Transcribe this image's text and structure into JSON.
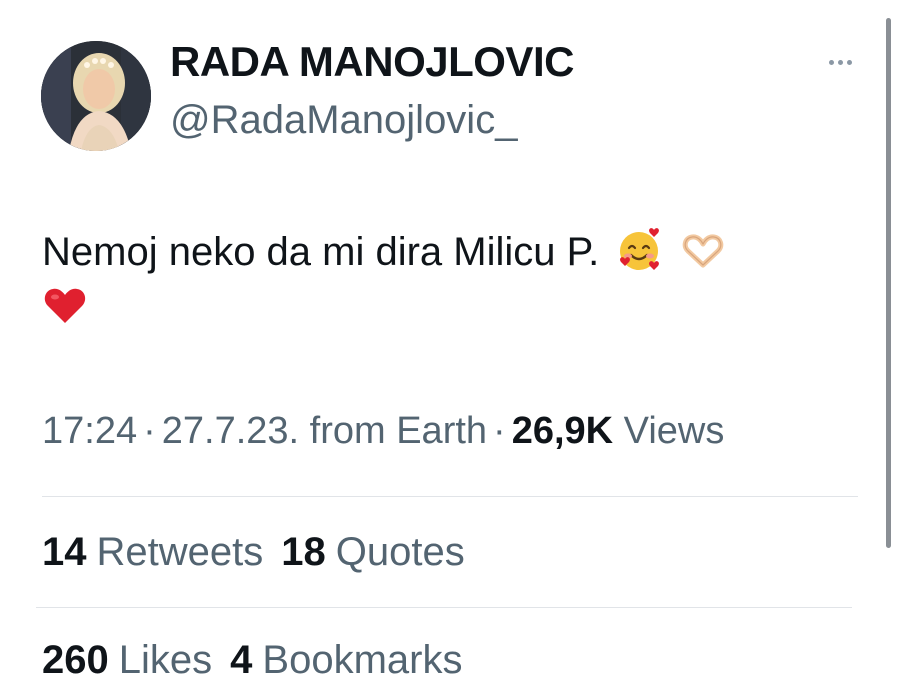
{
  "author": {
    "display_name": "RADA MANOJLOVIC",
    "handle": "@RadaManojlovic_",
    "avatar_icon": "profile-photo"
  },
  "menu": {
    "more_icon": "more-horizontal-icon"
  },
  "tweet": {
    "text_line1": "Nemoj neko da mi dira Milicu P.",
    "emojis_line1": [
      "smiling-face-with-hearts-icon",
      "heart-hands-icon"
    ],
    "emojis_line2": [
      "red-heart-icon"
    ]
  },
  "meta": {
    "time": "17:24",
    "separator": "·",
    "date": "27.7.23.",
    "source": "from Earth",
    "views_count": "26,9K",
    "views_label": "Views"
  },
  "stats": {
    "retweets_count": "14",
    "retweets_label": "Retweets",
    "quotes_count": "18",
    "quotes_label": "Quotes",
    "likes_count": "260",
    "likes_label": "Likes",
    "bookmarks_count": "4",
    "bookmarks_label": "Bookmarks"
  },
  "colors": {
    "text_primary": "#0f1419",
    "text_secondary": "#536471",
    "divider": "#e1e4e8",
    "heart_red": "#e0202f"
  }
}
